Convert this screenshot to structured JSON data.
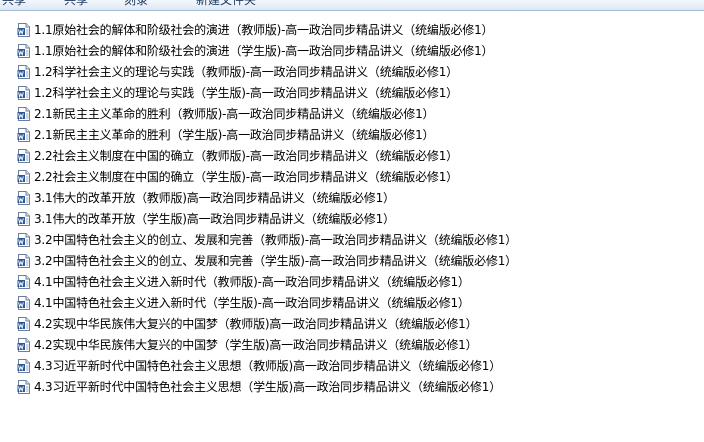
{
  "toolbar": {
    "items": [
      {
        "label": "共享"
      },
      {
        "label": "共享"
      },
      {
        "label": "刻录"
      },
      {
        "label": "新建文件夹"
      }
    ]
  },
  "files": [
    {
      "name": "1.1原始社会的解体和阶级社会的演进（教师版)-高一政治同步精品讲义（统编版必修1）",
      "icon": "word-doc-icon"
    },
    {
      "name": "1.1原始社会的解体和阶级社会的演进（学生版)-高一政治同步精品讲义（统编版必修1）",
      "icon": "word-doc-icon"
    },
    {
      "name": "1.2科学社会主义的理论与实践（教师版)-高一政治同步精品讲义（统编版必修1）",
      "icon": "word-doc-icon"
    },
    {
      "name": "1.2科学社会主义的理论与实践（学生版)-高一政治同步精品讲义（统编版必修1）",
      "icon": "word-doc-icon"
    },
    {
      "name": "2.1新民主主义革命的胜利（教师版)-高一政治同步精品讲义（统编版必修1）",
      "icon": "word-doc-icon"
    },
    {
      "name": "2.1新民主主义革命的胜利（学生版)-高一政治同步精品讲义（统编版必修1）",
      "icon": "word-doc-icon"
    },
    {
      "name": "2.2社会主义制度在中国的确立（教师版)-高一政治同步精品讲义（统编版必修1）",
      "icon": "word-doc-icon"
    },
    {
      "name": "2.2社会主义制度在中国的确立（学生版)-高一政治同步精品讲义（统编版必修1）",
      "icon": "word-doc-icon"
    },
    {
      "name": "3.1伟大的改革开放（教师版)高一政治同步精品讲义（统编版必修1）",
      "icon": "word-doc-icon"
    },
    {
      "name": "3.1伟大的改革开放（学生版)高一政治同步精品讲义（统编版必修1）",
      "icon": "word-doc-icon"
    },
    {
      "name": "3.2中国特色社会主义的创立、发展和完善（教师版)-高一政治同步精品讲义（统编版必修1）",
      "icon": "word-doc-icon"
    },
    {
      "name": "3.2中国特色社会主义的创立、发展和完善（学生版)-高一政治同步精品讲义（统编版必修1）",
      "icon": "word-doc-icon"
    },
    {
      "name": "4.1中国特色社会主义进入新时代（教师版)-高一政治同步精品讲义（统编版必修1）",
      "icon": "word-doc-icon"
    },
    {
      "name": "4.1中国特色社会主义进入新时代（学生版)-高一政治同步精品讲义（统编版必修1）",
      "icon": "word-doc-icon"
    },
    {
      "name": "4.2实现中华民族伟大复兴的中国梦（教师版)高一政治同步精品讲义（统编版必修1）",
      "icon": "word-doc-icon"
    },
    {
      "name": "4.2实现中华民族伟大复兴的中国梦（学生版)高一政治同步精品讲义（统编版必修1）",
      "icon": "word-doc-icon"
    },
    {
      "name": "4.3习近平新时代中国特色社会主义思想（教师版)高一政治同步精品讲义（统编版必修1）",
      "icon": "word-doc-icon"
    },
    {
      "name": "4.3习近平新时代中国特色社会主义思想（学生版)高一政治同步精品讲义（统编版必修1）",
      "icon": "word-doc-icon"
    }
  ]
}
